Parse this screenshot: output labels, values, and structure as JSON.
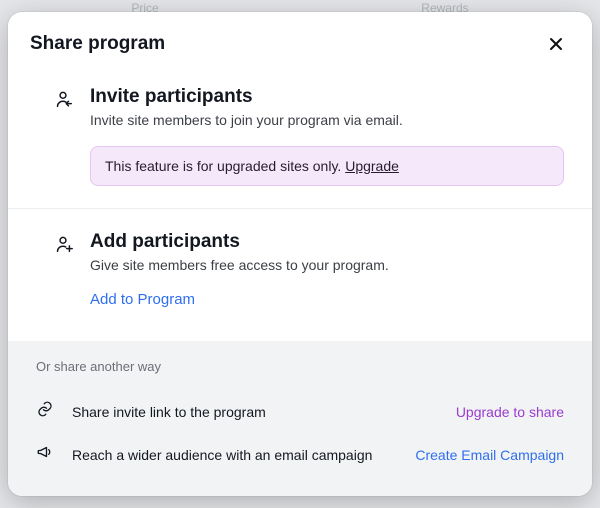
{
  "backdrop": {
    "hint_left": "Price",
    "hint_right": "Rewards"
  },
  "modal": {
    "title": "Share program"
  },
  "invite": {
    "title": "Invite participants",
    "desc": "Invite site members to join your program via email.",
    "banner_text": "This feature is for upgraded sites only.  ",
    "banner_link": "Upgrade"
  },
  "add": {
    "title": "Add participants",
    "desc": "Give site members free access to your program.",
    "action": "Add to Program"
  },
  "footer": {
    "heading": "Or share another way",
    "link_row": {
      "label": "Share invite link to the program",
      "action": "Upgrade to share"
    },
    "email_row": {
      "label": "Reach a wider audience with an email campaign",
      "action": "Create Email Campaign"
    }
  }
}
